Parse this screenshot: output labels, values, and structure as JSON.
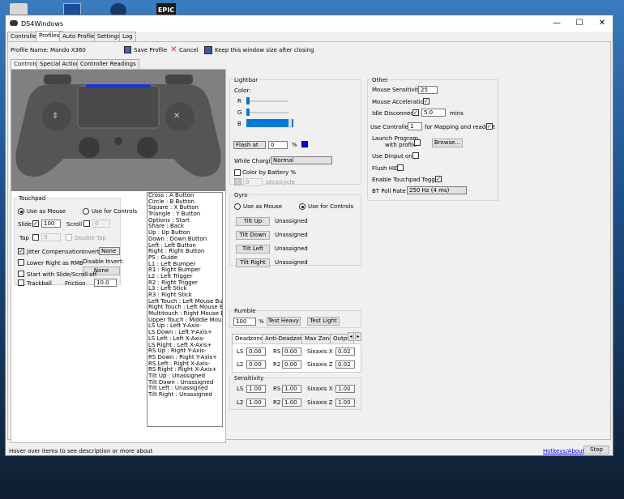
{
  "app": {
    "title": "DS4Windows"
  },
  "tabs": [
    "Controllers",
    "Profiles",
    "Auto Profiles",
    "Settings",
    "Log"
  ],
  "profile": {
    "name_label": "Profile Name:",
    "name_value": "Mando X360",
    "save_label": "Save Profile",
    "cancel_label": "Cancel",
    "keep_label": "Keep this window size after closing"
  },
  "subtabs": [
    "Controls",
    "Special Actions",
    "Controller Readings"
  ],
  "touchpad": {
    "title": "Touchpad",
    "use_mouse": "Use as Mouse",
    "use_controls": "Use for Controls",
    "slide": "Slide",
    "slide_value": "100",
    "scroll": "Scroll",
    "scroll_value": "0",
    "tap": "Tap",
    "tap_value": "0",
    "double_tap": "Double Tap",
    "jitter": "Jitter Compensation",
    "invert_label": "Invert:",
    "invert_value": "None",
    "lower_right": "Lower Right as RMB",
    "disable_invert": "Disable Invert:",
    "disable_invert_value": "None",
    "start_slide": "Start with Slide/Scroll off",
    "trackball": "Trackball",
    "friction": "Friction",
    "friction_value": "10.0"
  },
  "mappings": [
    "Cross : A Button",
    "Circle : B Button",
    "Square : X Button",
    "Triangle : Y Button",
    "Options : Start",
    "Share : Back",
    "Up : Up Button",
    "Down : Down Button",
    "Left : Left Button",
    "Right : Right Button",
    "PS : Guide",
    "L1 : Left Bumper",
    "R1 : Right Bumper",
    "L2 : Left Trigger",
    "R2 : Right Trigger",
    "L3 : Left Stick",
    "R3 : Right Stick",
    "Left Touch : Left Mouse Button",
    "Right Touch : Left Mouse Button",
    "Multitouch : Right Mouse Button",
    "Upper Touch : Middle Mouse Bu",
    "LS Up : Left Y-Axis-",
    "LS Down : Left Y-Axis+",
    "LS Left : Left X-Axis-",
    "LS Right : Left X-Axis+",
    "RS Up : Right Y-Axis-",
    "RS Down : Right Y-Axis+",
    "RS Left : Right X-Axis-",
    "RS Right : Right X-Axis+",
    "Tilt Up : Unassigned",
    "Tilt Down : Unassigned",
    "Tilt Left : Unassigned",
    "Tilt Right : Unassigned"
  ],
  "lightbar": {
    "title": "Lightbar",
    "color": "Color:",
    "r": "R",
    "g": "G",
    "b": "B",
    "color_value": "#0000ff",
    "flash_label": "Flash at",
    "flash_value": "0",
    "percent": "%",
    "while_charging": "While Charging:",
    "charging_value": "Normal",
    "color_by_battery": "Color by Battery %",
    "secs_value": "0",
    "secs_label": "secs/cycle"
  },
  "gyro": {
    "title": "Gyro",
    "use_mouse": "Use as Mouse",
    "use_controls": "Use for Controls",
    "tilt_up": "Tilt Up",
    "tilt_down": "Tilt Down",
    "tilt_left": "Tilt Left",
    "tilt_right": "Tilt Right",
    "unassigned": "Unassigned"
  },
  "rumble": {
    "title": "Rumble",
    "value": "100",
    "percent": "%",
    "test_heavy": "Test Heavy",
    "test_light": "Test Light"
  },
  "deadzone": {
    "tabs": [
      "Deadzone",
      "Anti-Deadzone",
      "Max Zone",
      "Outpu"
    ],
    "ls": "LS",
    "rs": "RS",
    "l2": "L2",
    "r2": "R2",
    "sixaxis_x": "Sixaxis X",
    "sixaxis_z": "Sixaxis Z",
    "ls_v": "0.00",
    "rs_v": "0.00",
    "l2_v": "0.00",
    "r2_v": "0.00",
    "sx_v": "0.02",
    "sz_v": "0.02"
  },
  "sensitivity": {
    "title": "Sensitivity",
    "ls": "LS",
    "rs": "RS",
    "l2": "L2",
    "r2": "R2",
    "sixaxis_x": "Sixaxis X",
    "sixaxis_z": "Sixaxis Z",
    "ls_v": "1.00",
    "rs_v": "1.00",
    "l2_v": "1.00",
    "r2_v": "1.00",
    "sx_v": "1.00",
    "sz_v": "1.00"
  },
  "other": {
    "title": "Other",
    "mouse_sens": "Mouse Sensitivity:",
    "mouse_sens_value": "25",
    "mouse_accel": "Mouse Acceleration",
    "idle": "Idle Disconnect",
    "idle_value": "5.0",
    "mins": "mins",
    "use_controller": "Use Controller",
    "controller_value": "1",
    "for_mapping": "for Mapping and readout",
    "launch_program": "Launch Program",
    "with_profile": "with profile",
    "browse": "Browse...",
    "dinput": "Use Dinput only",
    "flush_hid": "Flush HID",
    "touchpad_toggle": "Enable Touchpad Toggle",
    "bt_poll": "BT Poll Rate",
    "bt_poll_value": "250 Hz (4 ms)"
  },
  "status": {
    "hint": "Hover over items to see description or more about",
    "hotkeys": "Hotkeys/About",
    "stop": "Stop"
  },
  "desktop": {
    "epic": "EPIC"
  },
  "glyphs": {
    "min": "—",
    "max": "☐",
    "close": "✕",
    "check": "✓",
    "down": "▾",
    "spin": "⇕",
    "left": "◂",
    "right": "▸"
  }
}
